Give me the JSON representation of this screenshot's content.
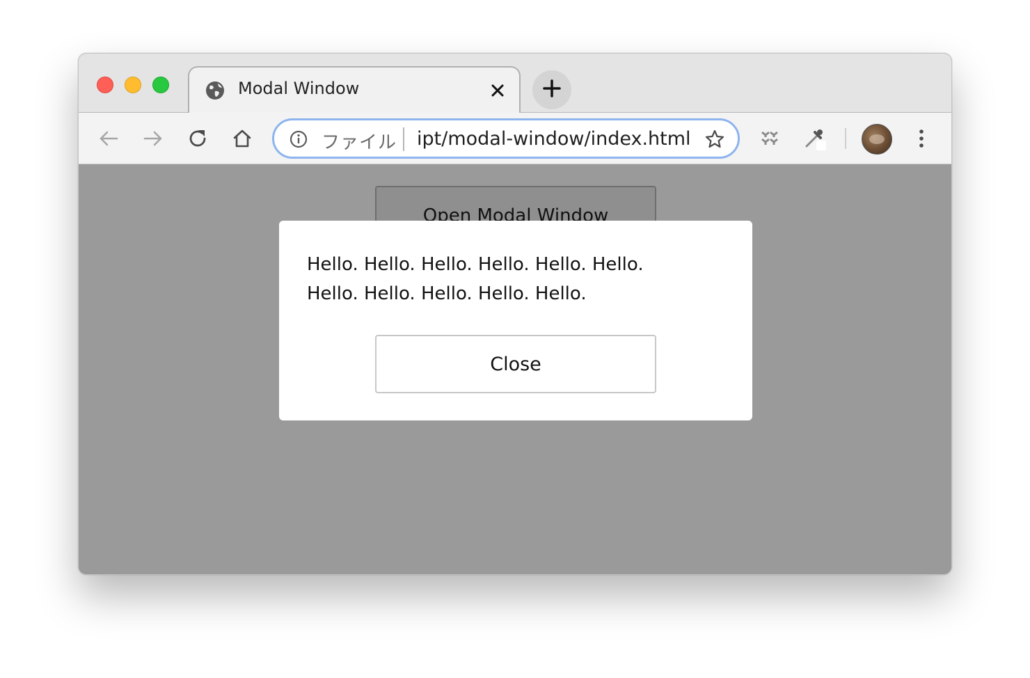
{
  "window": {
    "traffic_lights": [
      "close",
      "minimize",
      "zoom"
    ]
  },
  "tab": {
    "title": "Modal Window",
    "favicon": "globe-icon",
    "close_icon": "close-icon"
  },
  "newtab": {
    "icon": "plus-icon"
  },
  "toolbar": {
    "icons": [
      "back-arrow-icon",
      "forward-arrow-icon",
      "reload-icon",
      "home-icon",
      "extensions-icon",
      "eyedropper-icon",
      "more-vert-icon"
    ],
    "omnibox": {
      "scheme_label": "ファイル",
      "url": "ipt/modal-window/index.html",
      "info_icon": "info-icon",
      "star_icon": "star-icon"
    }
  },
  "page": {
    "open_button_label": "Open Modal Window",
    "modal": {
      "text": "Hello. Hello. Hello. Hello. Hello. Hello. Hello. Hello. Hello. Hello. Hello.",
      "close_button_label": "Close"
    }
  },
  "colors": {
    "overlay": "#9a9a9a",
    "modal_bg": "#ffffff",
    "omnibox_focus": "#8db4ee",
    "traffic_red": "#fe5f57",
    "traffic_yellow": "#febc2e",
    "traffic_green": "#28c840"
  }
}
